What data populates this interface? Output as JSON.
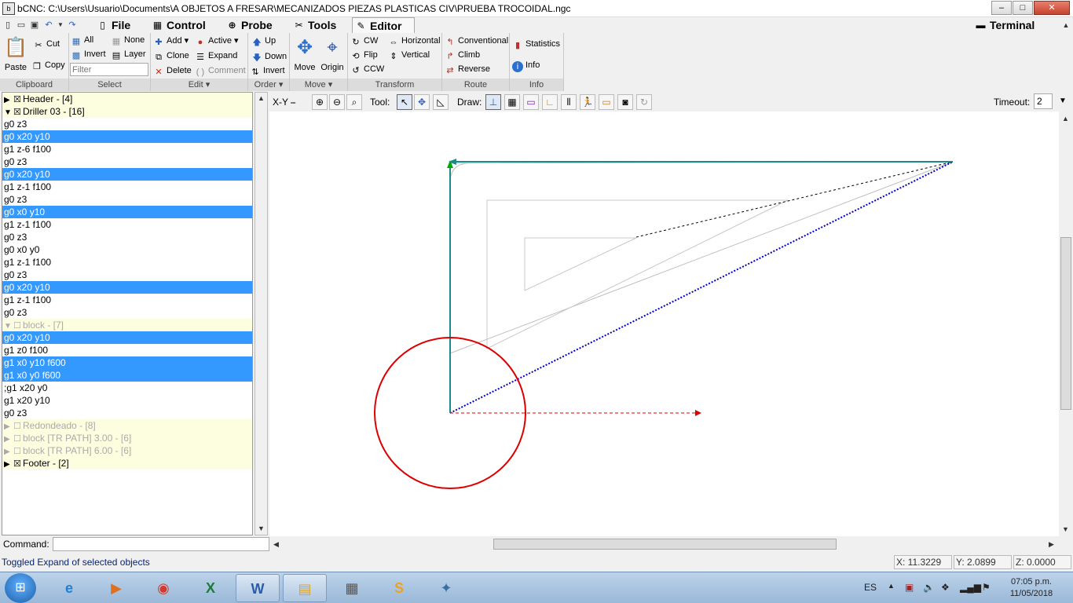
{
  "window": {
    "title": "bCNC: C:\\Users\\Usuario\\Documents\\A OBJETOS A FRESAR\\MECANIZADOS PIEZAS PLASTICAS CIV\\PRUEBA TROCOIDAL.ngc",
    "minimize": "–",
    "maximize": "□",
    "close": "✕"
  },
  "menu": {
    "tabs": [
      {
        "label": "File",
        "icon": "file-icon"
      },
      {
        "label": "Control",
        "icon": "control-icon"
      },
      {
        "label": "Probe",
        "icon": "probe-icon"
      },
      {
        "label": "Tools",
        "icon": "tools-icon"
      },
      {
        "label": "Editor",
        "icon": "editor-icon"
      }
    ],
    "terminal": "Terminal"
  },
  "ribbon": {
    "clipboard": {
      "group": "Clipboard",
      "paste": "Paste",
      "cut": "Cut",
      "copy": "Copy"
    },
    "select": {
      "group": "Select",
      "all": "All",
      "none": "None",
      "invert": "Invert",
      "layer": "Layer",
      "filter_placeholder": "Filter"
    },
    "edit": {
      "group": "Edit",
      "add": "Add",
      "active": "Active",
      "clone": "Clone",
      "expand": "Expand",
      "delete": "Delete",
      "comment": "Comment"
    },
    "order": {
      "group": "Order",
      "up": "Up",
      "down": "Down",
      "invert": "Invert"
    },
    "move": {
      "group": "Move",
      "move": "Move",
      "origin": "Origin"
    },
    "transform": {
      "group": "Transform",
      "cw": "CW",
      "horizontal": "Horizontal",
      "flip": "Flip",
      "vertical": "Vertical",
      "ccw": "CCW"
    },
    "route": {
      "group": "Route",
      "conventional": "Conventional",
      "climb": "Climb",
      "reverse": "Reverse"
    },
    "info": {
      "group": "Info",
      "statistics": "Statistics",
      "info": "Info"
    }
  },
  "editor_list": [
    {
      "type": "block",
      "expanded": false,
      "checked": true,
      "enabled": true,
      "text": "Header - [4]"
    },
    {
      "type": "block",
      "expanded": true,
      "checked": true,
      "enabled": true,
      "text": "Driller 03 - [16]"
    },
    {
      "type": "line",
      "selected": false,
      "text": "g0 z3"
    },
    {
      "type": "line",
      "selected": true,
      "text": "g0 x20 y10"
    },
    {
      "type": "line",
      "selected": false,
      "text": "g1 z-6 f100"
    },
    {
      "type": "line",
      "selected": false,
      "text": "g0 z3"
    },
    {
      "type": "line",
      "selected": true,
      "text": "g0 x20 y10"
    },
    {
      "type": "line",
      "selected": false,
      "text": "g1 z-1 f100"
    },
    {
      "type": "line",
      "selected": false,
      "text": "g0 z3"
    },
    {
      "type": "line",
      "selected": true,
      "text": "g0 x0 y10"
    },
    {
      "type": "line",
      "selected": false,
      "text": "g1 z-1 f100"
    },
    {
      "type": "line",
      "selected": false,
      "text": "g0 z3"
    },
    {
      "type": "line",
      "selected": false,
      "text": "g0 x0 y0"
    },
    {
      "type": "line",
      "selected": false,
      "text": "g1 z-1 f100"
    },
    {
      "type": "line",
      "selected": false,
      "text": "g0 z3"
    },
    {
      "type": "line",
      "selected": true,
      "text": "g0 x20 y10"
    },
    {
      "type": "line",
      "selected": false,
      "text": "g1 z-1 f100"
    },
    {
      "type": "line",
      "selected": false,
      "text": "g0 z3"
    },
    {
      "type": "block",
      "expanded": true,
      "checked": false,
      "enabled": false,
      "text": "block - [7]"
    },
    {
      "type": "line",
      "selected": true,
      "text": "g0 x20 y10"
    },
    {
      "type": "line",
      "selected": false,
      "text": "g1 z0 f100"
    },
    {
      "type": "line",
      "selected": true,
      "text": "g1 x0 y10 f600"
    },
    {
      "type": "line",
      "selected": true,
      "text": "g1 x0 y0 f600"
    },
    {
      "type": "line",
      "selected": false,
      "text": ";g1 x20 y0"
    },
    {
      "type": "line",
      "selected": false,
      "text": "g1 x20 y10"
    },
    {
      "type": "line",
      "selected": false,
      "text": "g0 z3"
    },
    {
      "type": "block",
      "expanded": false,
      "checked": false,
      "enabled": false,
      "text": "Redondeado - [8]"
    },
    {
      "type": "block",
      "expanded": false,
      "checked": false,
      "enabled": false,
      "text": "block [TR PATH] 3.00 - [6]"
    },
    {
      "type": "block",
      "expanded": false,
      "checked": false,
      "enabled": false,
      "text": "block [TR PATH] 6.00 - [6]"
    },
    {
      "type": "block",
      "expanded": false,
      "checked": true,
      "enabled": true,
      "text": "Footer - [2]"
    }
  ],
  "canvas_toolbar": {
    "view": "X-Y",
    "tool_label": "Tool:",
    "draw_label": "Draw:",
    "timeout_label": "Timeout:",
    "timeout_value": "2"
  },
  "command": {
    "label": "Command:",
    "value": ""
  },
  "status": {
    "message": "Toggled Expand of selected objects",
    "x": "X: 11.3229",
    "y": "Y: 2.0899",
    "z": "Z: 0.0000"
  },
  "taskbar": {
    "apps": [
      {
        "name": "internet-explorer",
        "glyph": "e",
        "color": "#1e7fd8"
      },
      {
        "name": "media-player",
        "glyph": "▶",
        "color": "#e07020"
      },
      {
        "name": "chrome",
        "glyph": "◉",
        "color": "#d33a2c"
      },
      {
        "name": "excel",
        "glyph": "X",
        "color": "#1d7a3c"
      },
      {
        "name": "word",
        "glyph": "W",
        "color": "#2a5caa"
      },
      {
        "name": "file-explorer",
        "glyph": "▤",
        "color": "#d6a531"
      },
      {
        "name": "calculator",
        "glyph": "▦",
        "color": "#555"
      },
      {
        "name": "sublime-text",
        "glyph": "S",
        "color": "#f0a11a"
      },
      {
        "name": "python",
        "glyph": "✦",
        "color": "#3a6ea5"
      }
    ],
    "lang": "ES",
    "time": "07:05 p.m.",
    "date": "11/05/2018"
  },
  "colors": {
    "selection": "#3399ff",
    "block_bg": "#fdfde0",
    "path_teal": "#1a8a8a",
    "path_blue": "#0000cc",
    "circle_red": "#dd0000"
  }
}
